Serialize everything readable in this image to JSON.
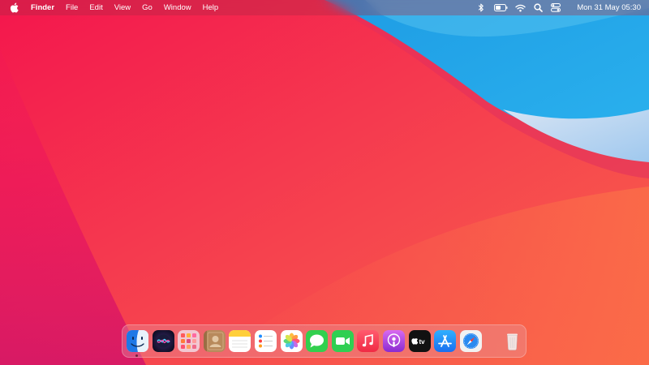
{
  "menubar": {
    "apple_icon": "apple-logo-icon",
    "app_name": "Finder",
    "menus": [
      "File",
      "Edit",
      "View",
      "Go",
      "Window",
      "Help"
    ],
    "status_icons": [
      "bluetooth-icon",
      "battery-icon",
      "wifi-icon",
      "spotlight-search-icon",
      "control-center-icon"
    ],
    "clock": "Mon 31 May 05:30"
  },
  "dock": {
    "apps": [
      {
        "name": "Finder",
        "icon": "finder-icon",
        "running": true
      },
      {
        "name": "Siri",
        "icon": "siri-icon",
        "running": false
      },
      {
        "name": "Launchpad",
        "icon": "launchpad-icon",
        "running": false
      },
      {
        "name": "Contacts",
        "icon": "contacts-icon",
        "running": false
      },
      {
        "name": "Notes",
        "icon": "notes-icon",
        "running": false
      },
      {
        "name": "Reminders",
        "icon": "reminders-icon",
        "running": false
      },
      {
        "name": "Photos",
        "icon": "photos-icon",
        "running": false
      },
      {
        "name": "Messages",
        "icon": "messages-icon",
        "running": false
      },
      {
        "name": "FaceTime",
        "icon": "facetime-icon",
        "running": false
      },
      {
        "name": "Music",
        "icon": "music-icon",
        "running": false
      },
      {
        "name": "Podcasts",
        "icon": "podcasts-icon",
        "running": false
      },
      {
        "name": "TV",
        "icon": "apple-tv-icon",
        "running": false,
        "label": "tv"
      },
      {
        "name": "App Store",
        "icon": "app-store-icon",
        "running": false
      },
      {
        "name": "Safari",
        "icon": "safari-icon",
        "running": false
      }
    ],
    "trash": {
      "name": "Trash",
      "icon": "trash-icon"
    }
  },
  "wallpaper": {
    "colors": {
      "red": "#f5284f",
      "orange": "#f8604a",
      "blue": "#1aa4e6",
      "light_blue": "#b8d8f2"
    }
  }
}
